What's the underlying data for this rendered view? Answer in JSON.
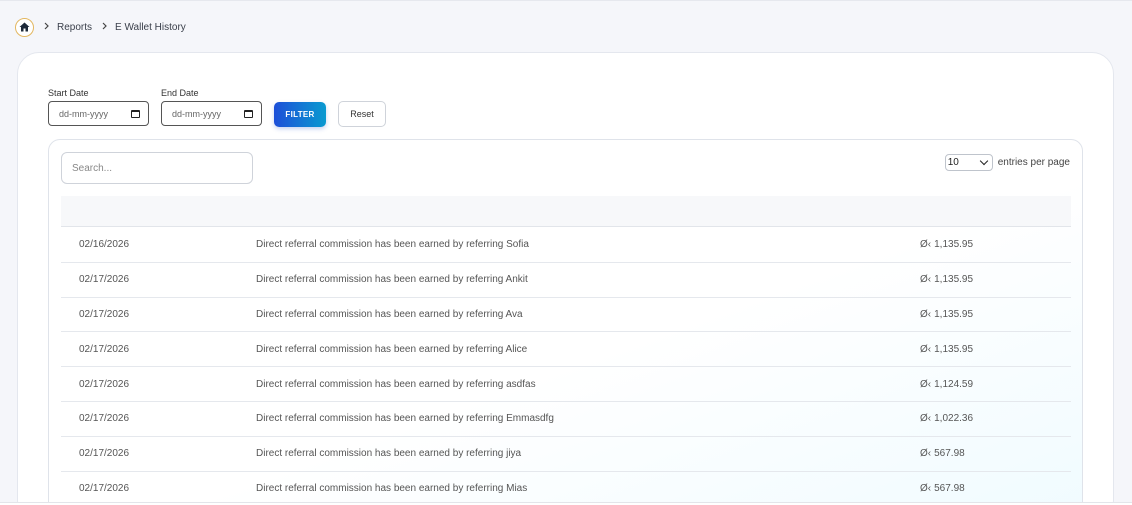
{
  "breadcrumb": {
    "items": [
      "Reports",
      "E Wallet History"
    ]
  },
  "filter": {
    "start_label": "Start Date",
    "start_placeholder": "dd-mm-yyyy",
    "end_label": "End Date",
    "end_placeholder": "dd-mm-yyyy",
    "filter_label": "FILTER",
    "reset_label": "Reset"
  },
  "table": {
    "search_placeholder": "Search...",
    "entries_value": "10",
    "entries_label": "entries per page",
    "currency_symbol": "Ø‹",
    "rows": [
      {
        "date": "02/16/2026",
        "description": "Direct referral commission has been earned by referring Sofia",
        "amount": "1,135.95"
      },
      {
        "date": "02/17/2026",
        "description": "Direct referral commission has been earned by referring Ankit",
        "amount": "1,135.95"
      },
      {
        "date": "02/17/2026",
        "description": "Direct referral commission has been earned by referring Ava",
        "amount": "1,135.95"
      },
      {
        "date": "02/17/2026",
        "description": "Direct referral commission has been earned by referring Alice",
        "amount": "1,135.95"
      },
      {
        "date": "02/17/2026",
        "description": "Direct referral commission has been earned by referring asdfas",
        "amount": "1,124.59"
      },
      {
        "date": "02/17/2026",
        "description": "Direct referral commission has been earned by referring Emmasdfg",
        "amount": "1,022.36"
      },
      {
        "date": "02/17/2026",
        "description": "Direct referral commission has been earned by referring jiya",
        "amount": "567.98"
      },
      {
        "date": "02/17/2026",
        "description": "Direct referral commission has been earned by referring Mias",
        "amount": "567.98"
      }
    ]
  },
  "colors": {
    "accent_start": "#1d4fd8",
    "accent_end": "#0a9ad0",
    "home_ring": "#e3b760"
  },
  "icons": {
    "home": "home-icon",
    "separator": "chevron-right-icon",
    "calendar": "calendar-icon",
    "dropdown": "chevron-down-icon"
  }
}
